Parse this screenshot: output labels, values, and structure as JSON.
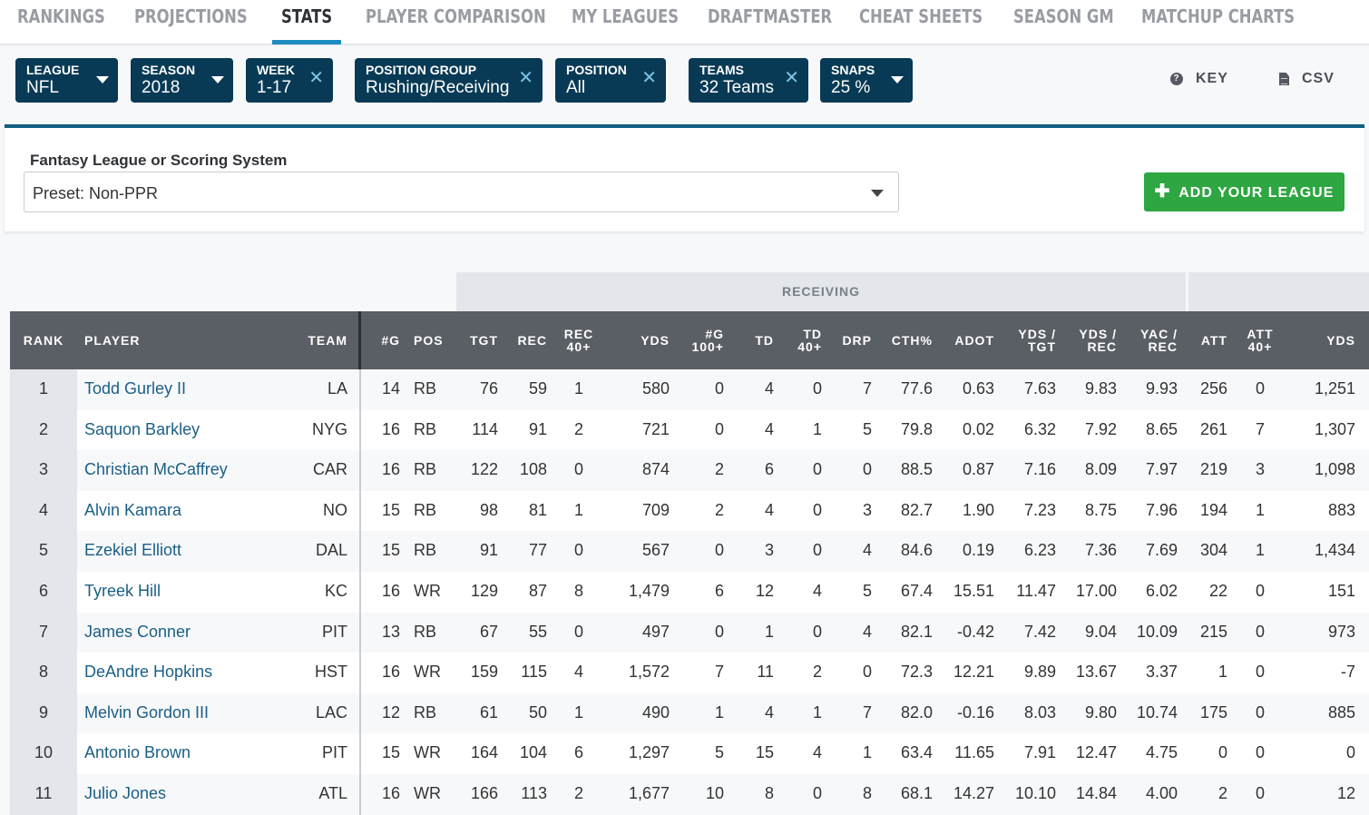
{
  "nav": {
    "items": [
      {
        "label": "RANKINGS",
        "active": false
      },
      {
        "label": "PROJECTIONS",
        "active": false
      },
      {
        "label": "STATS",
        "active": true
      },
      {
        "label": "PLAYER COMPARISON",
        "active": false
      },
      {
        "label": "MY LEAGUES",
        "active": false
      },
      {
        "label": "DRAFTMASTER",
        "active": false
      },
      {
        "label": "CHEAT SHEETS",
        "active": false
      },
      {
        "label": "SEASON GM",
        "active": false
      },
      {
        "label": "MATCHUP CHARTS",
        "active": false
      }
    ],
    "accent": "#1d8cc0"
  },
  "filters": [
    {
      "label": "LEAGUE",
      "value": "NFL",
      "control": "dropdown"
    },
    {
      "label": "SEASON",
      "value": "2018",
      "control": "dropdown"
    },
    {
      "label": "WEEK",
      "value": "1-17",
      "control": "clear"
    },
    {
      "label": "POSITION GROUP",
      "value": "Rushing/Receiving",
      "control": "clear"
    },
    {
      "label": "POSITION",
      "value": "All",
      "control": "clear"
    },
    {
      "label": "TEAMS",
      "value": "32 Teams",
      "control": "clear"
    },
    {
      "label": "SNAPS",
      "value": "25 %",
      "control": "dropdown"
    }
  ],
  "tools": {
    "key_label": "KEY",
    "key_icon": "question-circle-icon",
    "csv_label": "CSV",
    "csv_icon": "document-icon"
  },
  "scoring": {
    "label": "Fantasy League or Scoring System",
    "selected": "Preset: Non-PPR",
    "add_button": "ADD YOUR LEAGUE",
    "add_button_icon": "plus-icon",
    "add_button_color": "#2ea641"
  },
  "table": {
    "groups": {
      "receiving": "RECEIVING",
      "rushing": ""
    },
    "columns": [
      {
        "key": "rank",
        "label": "RANK"
      },
      {
        "key": "player",
        "label": "PLAYER"
      },
      {
        "key": "team",
        "label": "TEAM"
      },
      {
        "key": "g",
        "label": "#G"
      },
      {
        "key": "pos",
        "label": "POS"
      },
      {
        "key": "tgt",
        "label": "TGT"
      },
      {
        "key": "rec",
        "label": "REC"
      },
      {
        "key": "rec40",
        "label": "REC\n40+"
      },
      {
        "key": "yds",
        "label": "YDS"
      },
      {
        "key": "g100",
        "label": "#G\n100+"
      },
      {
        "key": "td",
        "label": "TD"
      },
      {
        "key": "td40",
        "label": "TD\n40+"
      },
      {
        "key": "drp",
        "label": "DRP"
      },
      {
        "key": "cth",
        "label": "CTH%"
      },
      {
        "key": "adot",
        "label": "ADOT"
      },
      {
        "key": "ydstgt",
        "label": "YDS /\nTGT"
      },
      {
        "key": "ydsrec",
        "label": "YDS /\nREC"
      },
      {
        "key": "yacrec",
        "label": "YAC /\nREC"
      },
      {
        "key": "att",
        "label": "ATT"
      },
      {
        "key": "att40",
        "label": "ATT\n40+"
      },
      {
        "key": "ruyds",
        "label": "YDS"
      }
    ],
    "rows": [
      {
        "rank": "1",
        "player": "Todd Gurley II",
        "team": "LA",
        "g": "14",
        "pos": "RB",
        "tgt": "76",
        "rec": "59",
        "rec40": "1",
        "yds": "580",
        "g100": "0",
        "td": "4",
        "td40": "0",
        "drp": "7",
        "cth": "77.6",
        "adot": "0.63",
        "ydstgt": "7.63",
        "ydsrec": "9.83",
        "yacrec": "9.93",
        "att": "256",
        "att40": "0",
        "ruyds": "1,251"
      },
      {
        "rank": "2",
        "player": "Saquon Barkley",
        "team": "NYG",
        "g": "16",
        "pos": "RB",
        "tgt": "114",
        "rec": "91",
        "rec40": "2",
        "yds": "721",
        "g100": "0",
        "td": "4",
        "td40": "1",
        "drp": "5",
        "cth": "79.8",
        "adot": "0.02",
        "ydstgt": "6.32",
        "ydsrec": "7.92",
        "yacrec": "8.65",
        "att": "261",
        "att40": "7",
        "ruyds": "1,307"
      },
      {
        "rank": "3",
        "player": "Christian McCaffrey",
        "team": "CAR",
        "g": "16",
        "pos": "RB",
        "tgt": "122",
        "rec": "108",
        "rec40": "0",
        "yds": "874",
        "g100": "2",
        "td": "6",
        "td40": "0",
        "drp": "0",
        "cth": "88.5",
        "adot": "0.87",
        "ydstgt": "7.16",
        "ydsrec": "8.09",
        "yacrec": "7.97",
        "att": "219",
        "att40": "3",
        "ruyds": "1,098"
      },
      {
        "rank": "4",
        "player": "Alvin Kamara",
        "team": "NO",
        "g": "15",
        "pos": "RB",
        "tgt": "98",
        "rec": "81",
        "rec40": "1",
        "yds": "709",
        "g100": "2",
        "td": "4",
        "td40": "0",
        "drp": "3",
        "cth": "82.7",
        "adot": "1.90",
        "ydstgt": "7.23",
        "ydsrec": "8.75",
        "yacrec": "7.96",
        "att": "194",
        "att40": "1",
        "ruyds": "883"
      },
      {
        "rank": "5",
        "player": "Ezekiel Elliott",
        "team": "DAL",
        "g": "15",
        "pos": "RB",
        "tgt": "91",
        "rec": "77",
        "rec40": "0",
        "yds": "567",
        "g100": "0",
        "td": "3",
        "td40": "0",
        "drp": "4",
        "cth": "84.6",
        "adot": "0.19",
        "ydstgt": "6.23",
        "ydsrec": "7.36",
        "yacrec": "7.69",
        "att": "304",
        "att40": "1",
        "ruyds": "1,434"
      },
      {
        "rank": "6",
        "player": "Tyreek Hill",
        "team": "KC",
        "g": "16",
        "pos": "WR",
        "tgt": "129",
        "rec": "87",
        "rec40": "8",
        "yds": "1,479",
        "g100": "6",
        "td": "12",
        "td40": "4",
        "drp": "5",
        "cth": "67.4",
        "adot": "15.51",
        "ydstgt": "11.47",
        "ydsrec": "17.00",
        "yacrec": "6.02",
        "att": "22",
        "att40": "0",
        "ruyds": "151"
      },
      {
        "rank": "7",
        "player": "James Conner",
        "team": "PIT",
        "g": "13",
        "pos": "RB",
        "tgt": "67",
        "rec": "55",
        "rec40": "0",
        "yds": "497",
        "g100": "0",
        "td": "1",
        "td40": "0",
        "drp": "4",
        "cth": "82.1",
        "adot": "-0.42",
        "ydstgt": "7.42",
        "ydsrec": "9.04",
        "yacrec": "10.09",
        "att": "215",
        "att40": "0",
        "ruyds": "973"
      },
      {
        "rank": "8",
        "player": "DeAndre Hopkins",
        "team": "HST",
        "g": "16",
        "pos": "WR",
        "tgt": "159",
        "rec": "115",
        "rec40": "4",
        "yds": "1,572",
        "g100": "7",
        "td": "11",
        "td40": "2",
        "drp": "0",
        "cth": "72.3",
        "adot": "12.21",
        "ydstgt": "9.89",
        "ydsrec": "13.67",
        "yacrec": "3.37",
        "att": "1",
        "att40": "0",
        "ruyds": "-7"
      },
      {
        "rank": "9",
        "player": "Melvin Gordon III",
        "team": "LAC",
        "g": "12",
        "pos": "RB",
        "tgt": "61",
        "rec": "50",
        "rec40": "1",
        "yds": "490",
        "g100": "1",
        "td": "4",
        "td40": "1",
        "drp": "7",
        "cth": "82.0",
        "adot": "-0.16",
        "ydstgt": "8.03",
        "ydsrec": "9.80",
        "yacrec": "10.74",
        "att": "175",
        "att40": "0",
        "ruyds": "885"
      },
      {
        "rank": "10",
        "player": "Antonio Brown",
        "team": "PIT",
        "g": "15",
        "pos": "WR",
        "tgt": "164",
        "rec": "104",
        "rec40": "6",
        "yds": "1,297",
        "g100": "5",
        "td": "15",
        "td40": "4",
        "drp": "1",
        "cth": "63.4",
        "adot": "11.65",
        "ydstgt": "7.91",
        "ydsrec": "12.47",
        "yacrec": "4.75",
        "att": "0",
        "att40": "0",
        "ruyds": "0"
      },
      {
        "rank": "11",
        "player": "Julio Jones",
        "team": "ATL",
        "g": "16",
        "pos": "WR",
        "tgt": "166",
        "rec": "113",
        "rec40": "2",
        "yds": "1,677",
        "g100": "10",
        "td": "8",
        "td40": "0",
        "drp": "8",
        "cth": "68.1",
        "adot": "14.27",
        "ydstgt": "10.10",
        "ydsrec": "14.84",
        "yacrec": "4.00",
        "att": "2",
        "att40": "0",
        "ruyds": "12"
      }
    ]
  }
}
